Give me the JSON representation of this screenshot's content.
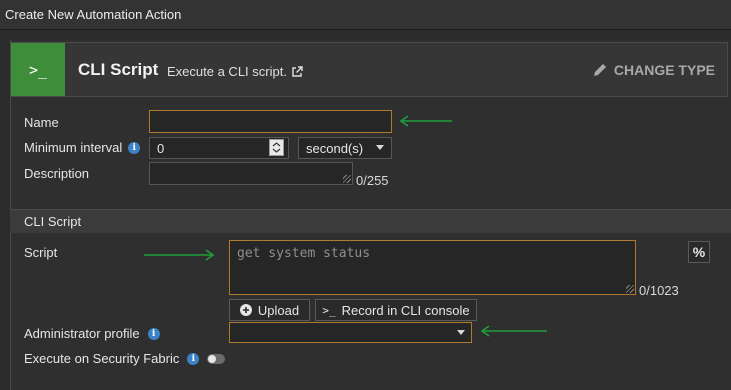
{
  "window": {
    "title": "Create New Automation Action"
  },
  "header": {
    "icon_glyph": ">_",
    "title": "CLI Script",
    "description": "Execute a CLI script.",
    "change_type_label": "CHANGE TYPE"
  },
  "form": {
    "name": {
      "label": "Name",
      "value": ""
    },
    "min_interval": {
      "label": "Minimum interval",
      "value": "0",
      "unit": "second(s)"
    },
    "description": {
      "label": "Description",
      "value": "",
      "counter": "0/255"
    }
  },
  "cli_section": {
    "title": "CLI Script",
    "script": {
      "label": "Script",
      "placeholder": "get system status",
      "counter": "0/1023",
      "percent_button": "%"
    },
    "upload_label": "Upload",
    "record_label": "Record in CLI console",
    "admin_profile": {
      "label": "Administrator profile",
      "value": ""
    },
    "fabric": {
      "label": "Execute on Security Fabric",
      "enabled": false
    }
  },
  "colors": {
    "accent_green": "#3e8d3a",
    "arrow_green": "#1f9d3a",
    "highlight_orange": "#b07a2c",
    "info_blue": "#3b83c6"
  }
}
